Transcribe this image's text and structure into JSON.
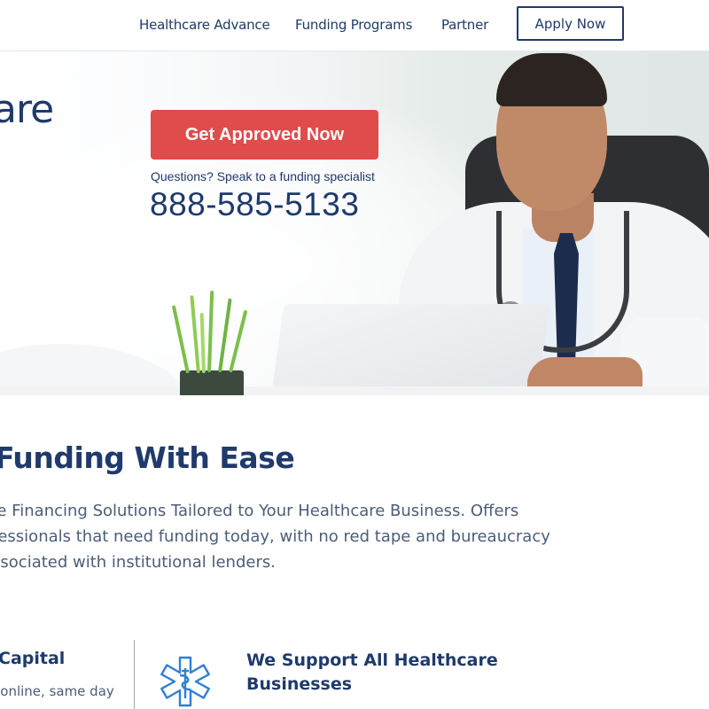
{
  "nav": {
    "links": [
      "Healthcare Advance",
      "Funding Programs",
      "Partner"
    ],
    "apply_label": "Apply Now"
  },
  "hero": {
    "title_fragment": "are",
    "cta_label": "Get Approved Now",
    "questions": "Questions? Speak to a funding specialist",
    "phone": "888-585-5133"
  },
  "intro": {
    "title": "Funding With Ease",
    "lines": [
      "ble Financing Solutions Tailored to Your Healthcare Business. Offers",
      "ofessionals that need funding today, with no red tape and bureaucracy",
      "associated with institutional lenders."
    ]
  },
  "features": {
    "first": {
      "title": "Capital",
      "text": "n online, same day"
    },
    "second": {
      "title_line1": "We Support All Healthcare",
      "title_line2": "Businesses",
      "icon": "star-of-life-icon"
    }
  },
  "colors": {
    "brand_navy": "#1f3a6b",
    "cta_red": "#e04b4b",
    "body_text": "#4b5d78",
    "icon_blue": "#2f7fd6"
  }
}
